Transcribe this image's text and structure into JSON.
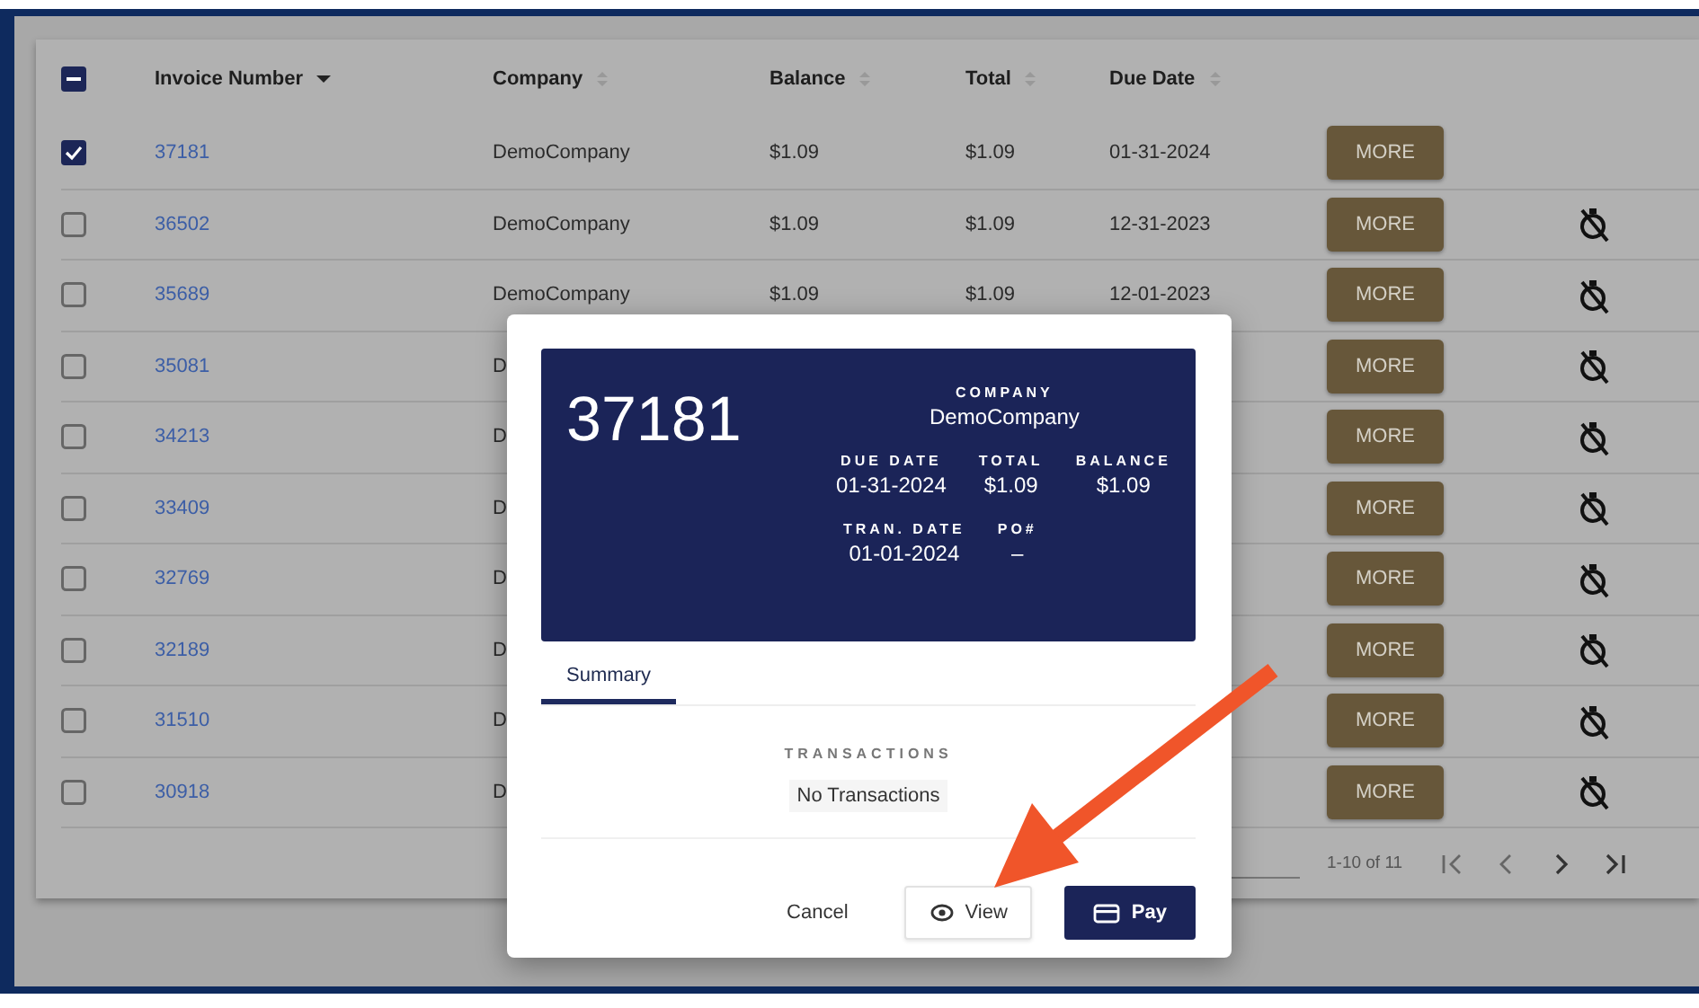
{
  "table": {
    "header_checkbox": {
      "indeterminate": true
    },
    "columns": [
      {
        "label": "Invoice Number",
        "sorted": true
      },
      {
        "label": "Company",
        "sorted": false
      },
      {
        "label": "Balance",
        "sorted": false
      },
      {
        "label": "Total",
        "sorted": false
      },
      {
        "label": "Due Date",
        "sorted": false
      }
    ],
    "rows": [
      {
        "selected": true,
        "invoice": "37181",
        "company": "DemoCompany",
        "balance": "$1.09",
        "total": "$1.09",
        "due_date": "01-31-2024",
        "action": "MORE",
        "timer_off": false
      },
      {
        "selected": false,
        "invoice": "36502",
        "company": "DemoCompany",
        "balance": "$1.09",
        "total": "$1.09",
        "due_date": "12-31-2023",
        "action": "MORE",
        "timer_off": true
      },
      {
        "selected": false,
        "invoice": "35689",
        "company": "DemoCompany",
        "balance": "$1.09",
        "total": "$1.09",
        "due_date": "12-01-2023",
        "action": "MORE",
        "timer_off": true
      },
      {
        "selected": false,
        "invoice": "35081",
        "company": "D",
        "action": "MORE",
        "timer_off": true
      },
      {
        "selected": false,
        "invoice": "34213",
        "company": "D",
        "action": "MORE",
        "timer_off": true
      },
      {
        "selected": false,
        "invoice": "33409",
        "company": "D",
        "action": "MORE",
        "timer_off": true
      },
      {
        "selected": false,
        "invoice": "32769",
        "company": "D",
        "action": "MORE",
        "timer_off": true
      },
      {
        "selected": false,
        "invoice": "32189",
        "company": "D",
        "action": "MORE",
        "timer_off": true
      },
      {
        "selected": false,
        "invoice": "31510",
        "company": "D",
        "action": "MORE",
        "timer_off": true
      },
      {
        "selected": false,
        "invoice": "30918",
        "company": "D",
        "action": "MORE",
        "timer_off": true
      }
    ],
    "pagination": {
      "range": "1-10 of 11"
    }
  },
  "modal": {
    "invoice": "37181",
    "field_rows": [
      [
        {
          "label": "COMPANY",
          "value": "DemoCompany"
        }
      ],
      [
        {
          "label": "DUE DATE",
          "value": "01-31-2024"
        },
        {
          "label": "TOTAL",
          "value": "$1.09"
        },
        {
          "label": "BALANCE",
          "value": "$1.09"
        }
      ],
      [
        {
          "label": "TRAN. DATE",
          "value": "01-01-2024"
        },
        {
          "label": "PO#",
          "value": "–"
        }
      ]
    ],
    "tabs": [
      {
        "label": "Summary",
        "selected": true
      }
    ],
    "transactions_label": "TRANSACTIONS",
    "transactions_empty": "No Transactions",
    "buttons": [
      {
        "label": "Cancel",
        "kind": "text"
      },
      {
        "label": "View",
        "kind": "outlined"
      },
      {
        "label": "Pay",
        "kind": "primary"
      }
    ]
  }
}
